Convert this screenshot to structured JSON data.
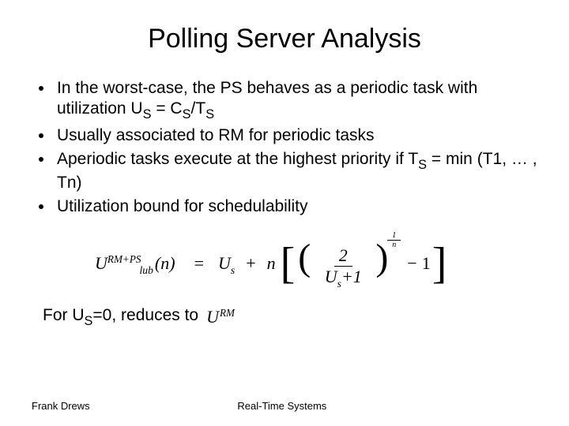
{
  "title": "Polling Server Analysis",
  "bullets": {
    "b1a": "In the worst-case, the PS behaves as a periodic task with utilization U",
    "b1_sub1": "S",
    "b1b": " = C",
    "b1_sub2": "S",
    "b1c": "/T",
    "b1_sub3": "S",
    "b2": "Usually associated to RM for periodic tasks",
    "b3a": "Aperiodic tasks execute at the highest priority if T",
    "b3_sub": "S",
    "b3b": " = min (T1, … , Tn)",
    "b4": "Utilization bound for schedulability"
  },
  "formula": {
    "U": "U",
    "sup": "RM+PS",
    "sub": "lub",
    "arg": "(n)",
    "eq": "=",
    "Us_U": "U",
    "Us_s": "s",
    "plus": "+",
    "n": "n",
    "frac_num": "2",
    "frac_den_U": "U",
    "frac_den_s": "s",
    "frac_den_rest": "+1",
    "pow_num": "1",
    "pow_den": "n",
    "minus": "−",
    "one": "1"
  },
  "reduces": {
    "prefix": "For U",
    "sub": "S",
    "rest": "=0, reduces to",
    "U": "U",
    "sup": "RM"
  },
  "footer": {
    "left": "Frank Drews",
    "center": "Real-Time Systems"
  }
}
